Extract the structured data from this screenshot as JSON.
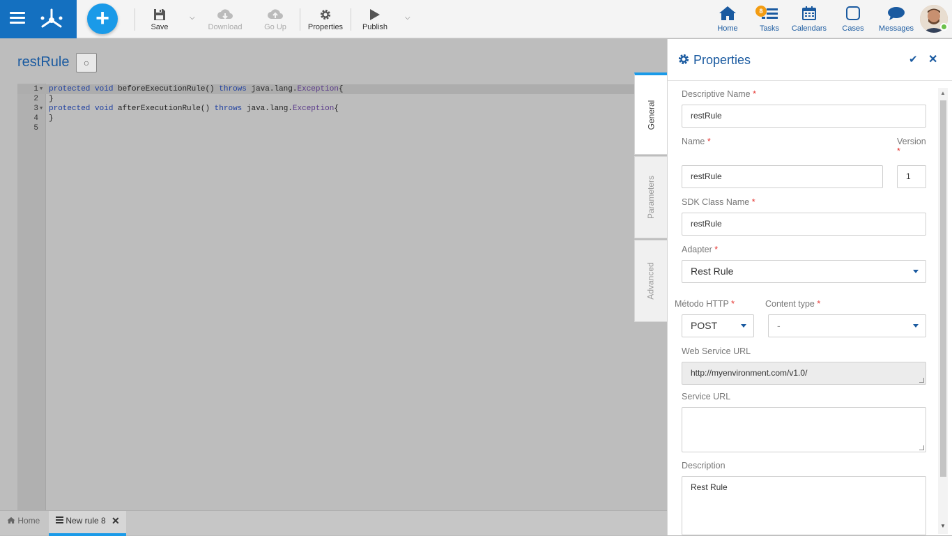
{
  "toolbar": {
    "save": "Save",
    "download": "Download",
    "go_up": "Go Up",
    "properties": "Properties",
    "publish": "Publish"
  },
  "nav": {
    "home": "Home",
    "tasks": "Tasks",
    "tasks_badge": "8",
    "calendars": "Calendars",
    "cases": "Cases",
    "messages": "Messages"
  },
  "editor": {
    "title": "restRule",
    "title_button": "○",
    "lines": [
      {
        "num": "1",
        "fold": true,
        "tokens": [
          [
            "kw",
            "protected"
          ],
          [
            "t",
            " "
          ],
          [
            "kw",
            "void"
          ],
          [
            "t",
            " beforeExecutionRule() "
          ],
          [
            "kw",
            "throws"
          ],
          [
            "t",
            " java.lang."
          ],
          [
            "cls",
            "Exception"
          ],
          [
            "t",
            "{"
          ]
        ]
      },
      {
        "num": "2",
        "fold": false,
        "tokens": [
          [
            "t",
            "}"
          ]
        ]
      },
      {
        "num": "3",
        "fold": true,
        "tokens": [
          [
            "kw",
            "protected"
          ],
          [
            "t",
            " "
          ],
          [
            "kw",
            "void"
          ],
          [
            "t",
            " afterExecutionRule() "
          ],
          [
            "kw",
            "throws"
          ],
          [
            "t",
            " java.lang."
          ],
          [
            "cls",
            "Exception"
          ],
          [
            "t",
            "{"
          ]
        ]
      },
      {
        "num": "4",
        "fold": false,
        "tokens": [
          [
            "t",
            "}"
          ]
        ]
      },
      {
        "num": "5",
        "fold": false,
        "tokens": []
      }
    ]
  },
  "side_tabs": {
    "general": "General",
    "parameters": "Parameters",
    "advanced": "Advanced"
  },
  "panel": {
    "title": "Properties",
    "descriptive_name_label": "Descriptive Name",
    "descriptive_name": "restRule",
    "name_label": "Name",
    "name": "restRule",
    "version_label": "Version",
    "version": "1",
    "sdk_class_label": "SDK Class Name",
    "sdk_class": "restRule",
    "adapter_label": "Adapter",
    "adapter": "Rest Rule",
    "http_method_label": "Método HTTP",
    "http_method": "POST",
    "content_type_label": "Content type",
    "content_type": "-",
    "ws_url_label": "Web Service URL",
    "ws_url": "http://myenvironment.com/v1.0/",
    "service_url_label": "Service URL",
    "service_url": "",
    "description_label": "Description",
    "description": "Rest Rule",
    "required_mark": "*"
  },
  "bottom_tabs": {
    "home": "Home",
    "rule": "New rule 8"
  },
  "colors": {
    "brand_blue": "#1470c0",
    "accent": "#1a9ae8",
    "required": "#e53935"
  }
}
